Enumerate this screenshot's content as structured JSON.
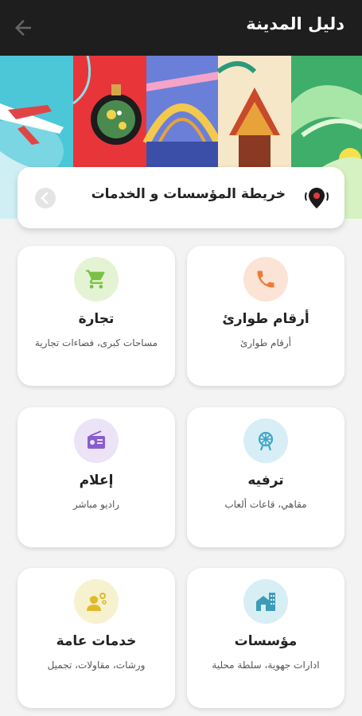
{
  "appbar": {
    "title": "دليل المدينة",
    "back_icon": "arrow-left-icon"
  },
  "map_bar": {
    "label": "خريطة المؤسسات و الخدمات",
    "icon": "map-pin-icon",
    "chevron_icon": "chevron-left-icon"
  },
  "cards": [
    {
      "title": "أرقام طوارئ",
      "subtitle": "أرقام طوارئ",
      "icon": "phone-icon",
      "circle_color": "#fbe3d6",
      "icon_color": "#f07a3a"
    },
    {
      "title": "تجارة",
      "subtitle": "مساحات كبرى، فضاءات تجارية",
      "icon": "shopping-cart-icon",
      "circle_color": "#e5f3d5",
      "icon_color": "#7ac143"
    },
    {
      "title": "ترفيه",
      "subtitle": "مقاهي، قاعات ألعاب",
      "icon": "ferris-wheel-icon",
      "circle_color": "#d8eef6",
      "icon_color": "#3fa6c8"
    },
    {
      "title": "إعلام",
      "subtitle": "راديو مباشر",
      "icon": "radio-icon",
      "circle_color": "#ece3f7",
      "icon_color": "#8a5cd0"
    },
    {
      "title": "مؤسسات",
      "subtitle": "ادارات جهوية، سلطة محلية",
      "icon": "building-icon",
      "circle_color": "#d7eef4",
      "icon_color": "#3d9bb8"
    },
    {
      "title": "خدمات عامة",
      "subtitle": "ورشات، مقاولات، تجميل",
      "icon": "worker-gears-icon",
      "circle_color": "#f6f1cf",
      "icon_color": "#e0b92a"
    }
  ]
}
